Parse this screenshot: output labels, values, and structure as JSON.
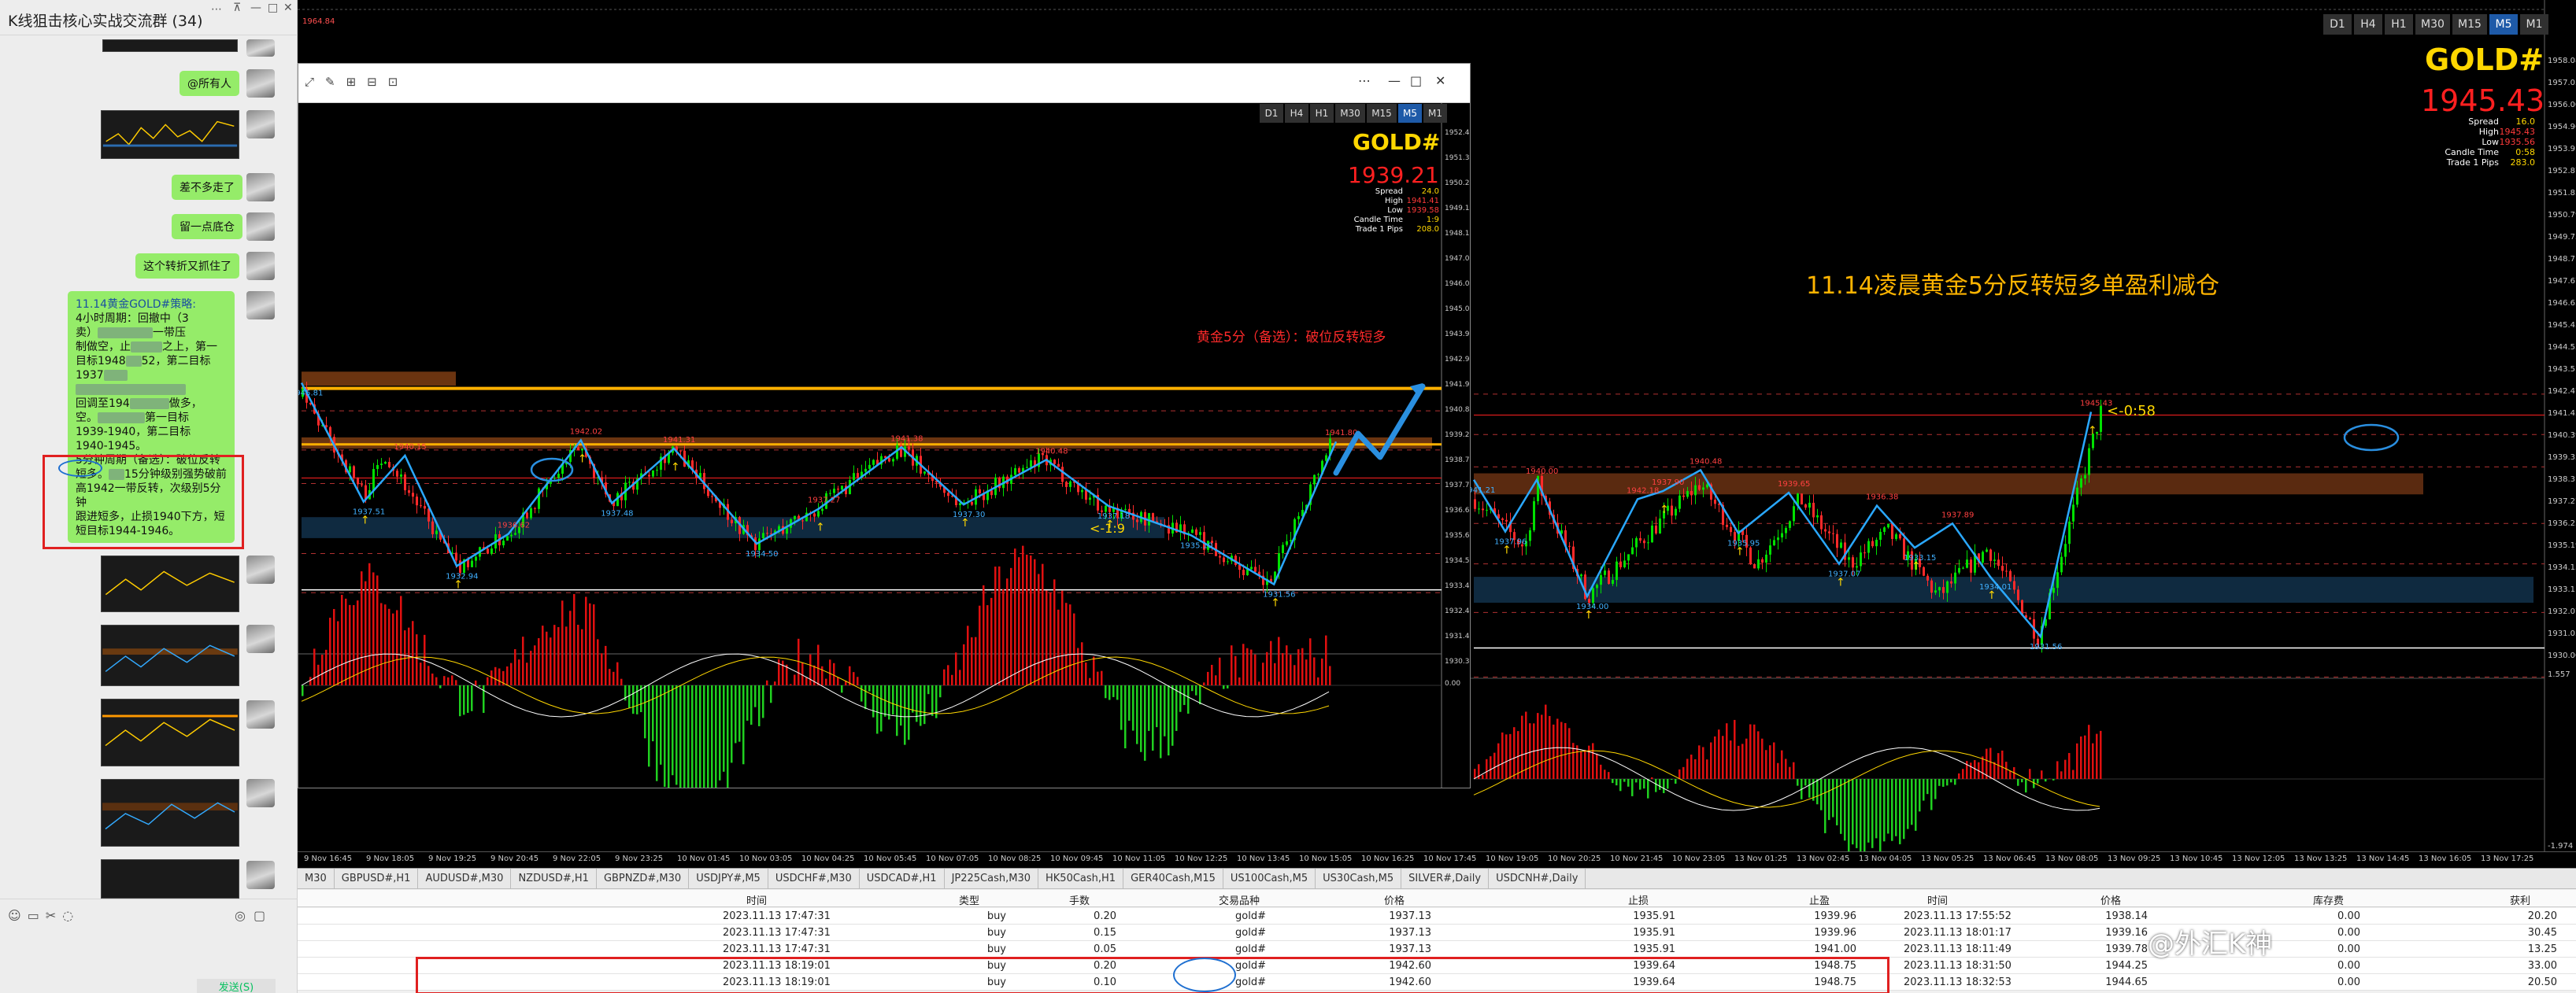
{
  "chat": {
    "title": "K线狙击核心实战交流群 (34)",
    "messages": [
      "@所有人",
      "差不多走了",
      "留一点底仓",
      "这个转折又抓住了"
    ],
    "big_message": {
      "line1": "11.14黄金GOLD#策略:",
      "line2": "4小时周期：回撤中（3",
      "line3": "卖）",
      "line3b": "一带压",
      "line4": "制做空，止",
      "line4b": "之上，第一",
      "line5": "目标1948",
      "line5b": "52，第二目标",
      "line6": "1937",
      "line8": "回调至194",
      "line8b": "做多，",
      "line9": "空。",
      "line9b": "第一目标",
      "line10": "1939-1940，第二目标",
      "line11": "1940-1945。",
      "line12": "5分钟周期（备选）：破位反转",
      "line13": "短多。",
      "line13b": "15分钟级别强势破前",
      "line14": "高1942一带反转，次级别5分钟",
      "line15": "跟进短多，止损1940下方，短",
      "line16": "短目标1944-1946。"
    },
    "bottom_button": "发送(S)"
  },
  "left_chart": {
    "symbol": "GOLD#",
    "price": "1939.21",
    "timeframes": [
      "D1",
      "H4",
      "H1",
      "M30",
      "M15",
      "M5",
      "M1"
    ],
    "active_tf": "M5",
    "info": [
      {
        "k": "Spread",
        "v": "24.0"
      },
      {
        "k": "High",
        "v": "1941.41"
      },
      {
        "k": "Low",
        "v": "1939.58"
      },
      {
        "k": "Candle Time",
        "v": "1:9"
      },
      {
        "k": "Trade 1 Pips",
        "v": "208.0"
      }
    ],
    "annotation": "黄金5分（备选）：破位反转短多",
    "countdown": "<-1:9",
    "price_axis": [
      "1952.48",
      "1951.30",
      "1950.24",
      "1949.19",
      "1948.16",
      "1947.08",
      "1946.04",
      "1945.02",
      "1943.96",
      "1942.93",
      "1941.90",
      "1940.84",
      "1939.21",
      "1938.73",
      "1937.72",
      "1936.64",
      "1935.63",
      "1934.53",
      "1933.49",
      "1932.45",
      "1931.41",
      "1930.38"
    ],
    "indicator_label": "0.00",
    "pivots": [
      "1945.81",
      "1940.15",
      "1933.25",
      "1932.94",
      "1934.46",
      "1935.15",
      "1936.38",
      "1942.02",
      "1937.51",
      "1941.31",
      "1934.50",
      "1941.38",
      "1936.62",
      "1940.48",
      "1937.27",
      "1935.10",
      "1934.01",
      "1931.56",
      "1939.37",
      "1941.80"
    ]
  },
  "right_chart": {
    "symbol": "GOLD#",
    "price": "1945.43",
    "timeframes": [
      "D1",
      "H4",
      "H1",
      "M30",
      "M15",
      "M5",
      "M1"
    ],
    "active_tf": "M5",
    "info": [
      {
        "k": "Spread",
        "v": "16.0"
      },
      {
        "k": "High",
        "v": "1945.43"
      },
      {
        "k": "Low",
        "v": "1935.56"
      },
      {
        "k": "Candle Time",
        "v": "0:58"
      },
      {
        "k": "Trade 1 Pips",
        "v": "283.0"
      }
    ],
    "title": "11.14凌晨黄金5分反转短多单盈利减仓",
    "countdown": "<-0:58",
    "price_axis": [
      "1958.08",
      "1957.03",
      "1956.00",
      "1954.96",
      "1953.91",
      "1952.87",
      "1951.83",
      "1950.79",
      "1949.75",
      "1948.71",
      "1947.67",
      "1946.63",
      "1945.43",
      "1944.55",
      "1943.51",
      "1942.47",
      "1941.43",
      "1940.39",
      "1939.35",
      "1938.31",
      "1937.27",
      "1936.23",
      "1935.19",
      "1934.15",
      "1933.11",
      "1932.07",
      "1931.03",
      "1930.00"
    ],
    "indicator_labels": [
      "1.557",
      "-1.974"
    ],
    "pivots": [
      "1941.21",
      "1940.00",
      "1942.18",
      "1940.48",
      "1939.65",
      "1937.96",
      "1934.00",
      "1937.90",
      "1935.95",
      "1937.07",
      "1933.15",
      "1934.01",
      "1931.56",
      "1945.43"
    ]
  },
  "time_axis": [
    "9 Nov 16:45",
    "9 Nov 18:05",
    "9 Nov 19:25",
    "9 Nov 20:45",
    "9 Nov 22:05",
    "9 Nov 23:25",
    "10 Nov 01:45",
    "10 Nov 03:05",
    "10 Nov 04:25",
    "10 Nov 05:45",
    "10 Nov 07:05",
    "10 Nov 08:25",
    "10 Nov 09:45",
    "10 Nov 11:05",
    "10 Nov 12:25",
    "10 Nov 13:45",
    "10 Nov 15:05",
    "10 Nov 16:25",
    "10 Nov 17:45",
    "10 Nov 19:05",
    "10 Nov 20:25",
    "10 Nov 21:45",
    "10 Nov 23:05",
    "13 Nov 01:25",
    "13 Nov 02:45",
    "13 Nov 04:05",
    "13 Nov 05:25",
    "13 Nov 06:45",
    "13 Nov 08:05",
    "13 Nov 09:25",
    "13 Nov 10:45",
    "13 Nov 12:05",
    "13 Nov 13:25",
    "13 Nov 14:45",
    "13 Nov 16:05",
    "13 Nov 17:25"
  ],
  "terminal": {
    "tabs": [
      "M30",
      "GBPUSD#,H1",
      "AUDUSD#,M30",
      "NZDUSD#,H1",
      "GBPNZD#,M30",
      "USDJPY#,M5",
      "USDCHF#,M30",
      "USDCAD#,H1",
      "JP225Cash,M30",
      "HK50Cash,H1",
      "GER40Cash,M15",
      "US100Cash,M5",
      "US30Cash,M5",
      "SILVER#,Daily",
      "USDCNH#,Daily"
    ],
    "headers": [
      "时间",
      "类型",
      "手数",
      "交易品种",
      "价格",
      "止损",
      "止盈",
      "时间",
      "价格",
      "库存费",
      "获利"
    ],
    "rows": [
      [
        "2023.11.13 17:47:31",
        "buy",
        "0.20",
        "gold#",
        "1937.13",
        "1935.91",
        "1939.96",
        "2023.11.13 17:55:52",
        "1938.14",
        "0.00",
        "20.20"
      ],
      [
        "2023.11.13 17:47:31",
        "buy",
        "0.15",
        "gold#",
        "1937.13",
        "1935.91",
        "1939.96",
        "2023.11.13 18:01:17",
        "1939.16",
        "0.00",
        "30.45"
      ],
      [
        "2023.11.13 17:47:31",
        "buy",
        "0.05",
        "gold#",
        "1937.13",
        "1935.91",
        "1941.00",
        "2023.11.13 18:11:49",
        "1939.78",
        "0.00",
        "13.25"
      ],
      [
        "2023.11.13 18:19:01",
        "buy",
        "0.20",
        "gold#",
        "1942.60",
        "1939.64",
        "1948.75",
        "2023.11.13 18:31:50",
        "1944.25",
        "0.00",
        "33.00"
      ],
      [
        "2023.11.13 18:19:01",
        "buy",
        "0.10",
        "gold#",
        "1942.60",
        "1939.64",
        "1948.75",
        "2023.11.13 18:32:53",
        "1944.65",
        "0.00",
        "20.50"
      ]
    ]
  },
  "watermark": "@外汇K神"
}
